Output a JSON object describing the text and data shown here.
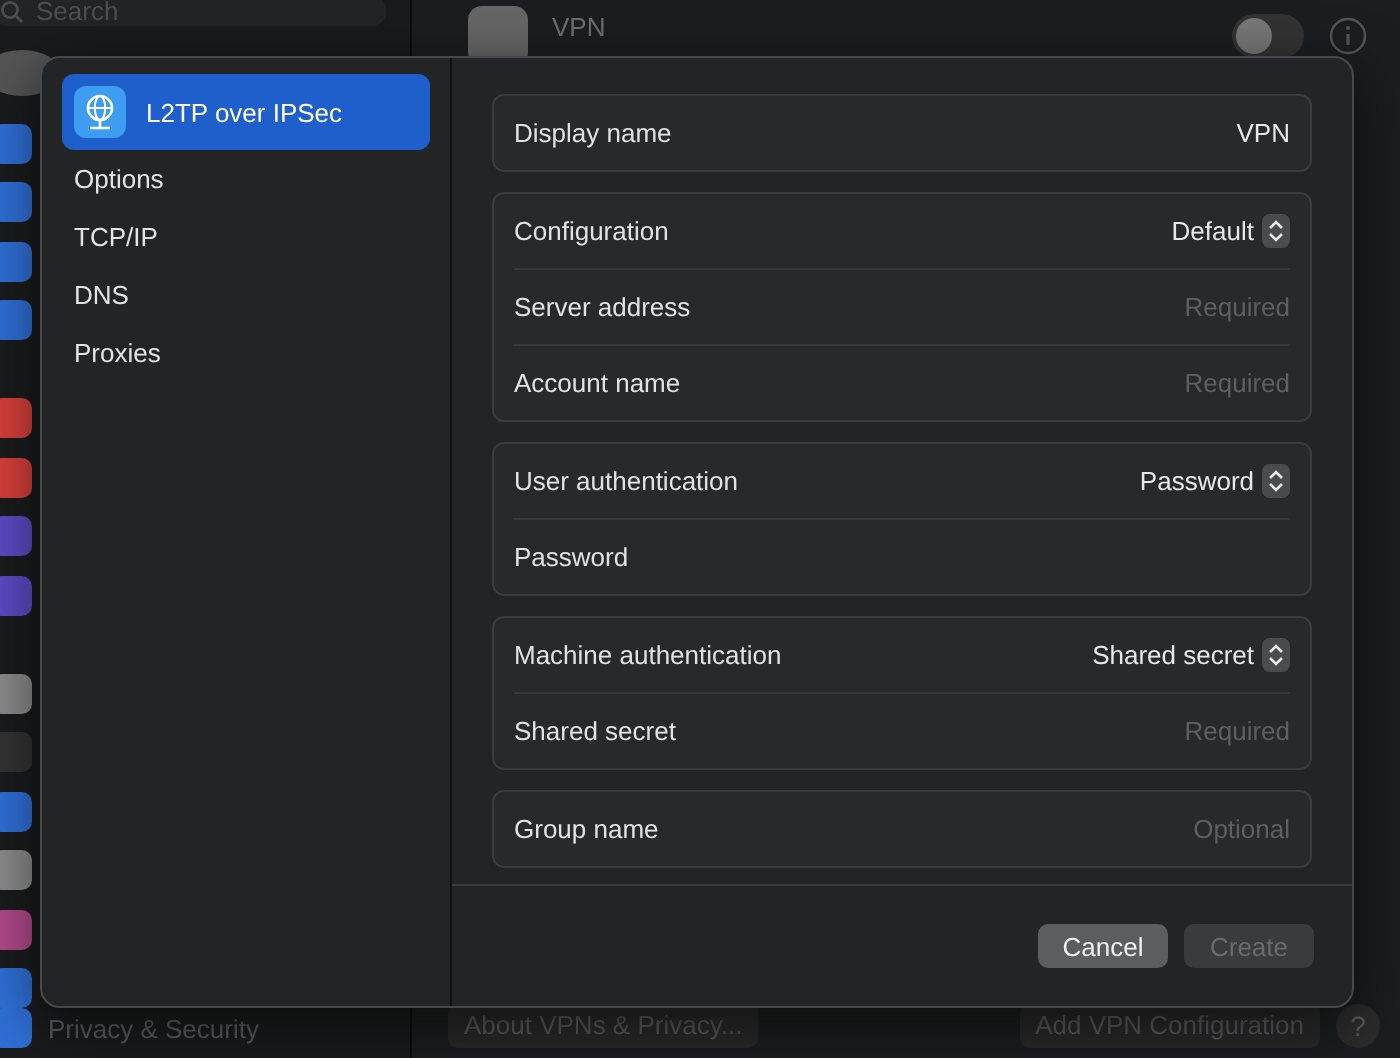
{
  "background": {
    "search": {
      "placeholder": "Search"
    },
    "sidebar_footer": "Privacy & Security",
    "vpn": {
      "title": "VPN",
      "on": false
    },
    "buttons": [
      "About VPNs & Privacy...",
      "Add VPN Configuration"
    ],
    "help": "?"
  },
  "dialog": {
    "nav": [
      {
        "label": "L2TP over IPSec",
        "selected": true,
        "kind": "service"
      },
      {
        "label": "Options",
        "selected": false,
        "kind": "page"
      },
      {
        "label": "TCP/IP",
        "selected": false,
        "kind": "page"
      },
      {
        "label": "DNS",
        "selected": false,
        "kind": "page"
      },
      {
        "label": "Proxies",
        "selected": false,
        "kind": "page"
      }
    ],
    "groups": [
      [
        {
          "label": "Display name",
          "kind": "text",
          "value": "VPN"
        }
      ],
      [
        {
          "label": "Configuration",
          "kind": "popup",
          "value": "Default"
        },
        {
          "label": "Server address",
          "kind": "text",
          "placeholder": "Required"
        },
        {
          "label": "Account name",
          "kind": "text",
          "placeholder": "Required"
        }
      ],
      [
        {
          "label": "User authentication",
          "kind": "popup",
          "value": "Password"
        },
        {
          "label": "Password",
          "kind": "text"
        }
      ],
      [
        {
          "label": "Machine authentication",
          "kind": "popup",
          "value": "Shared secret"
        },
        {
          "label": "Shared secret",
          "kind": "text",
          "placeholder": "Required"
        }
      ],
      [
        {
          "label": "Group name",
          "kind": "text",
          "placeholder": "Optional"
        }
      ]
    ],
    "buttons": [
      {
        "label": "Cancel",
        "disabled": false
      },
      {
        "label": "Create",
        "disabled": true
      }
    ]
  }
}
